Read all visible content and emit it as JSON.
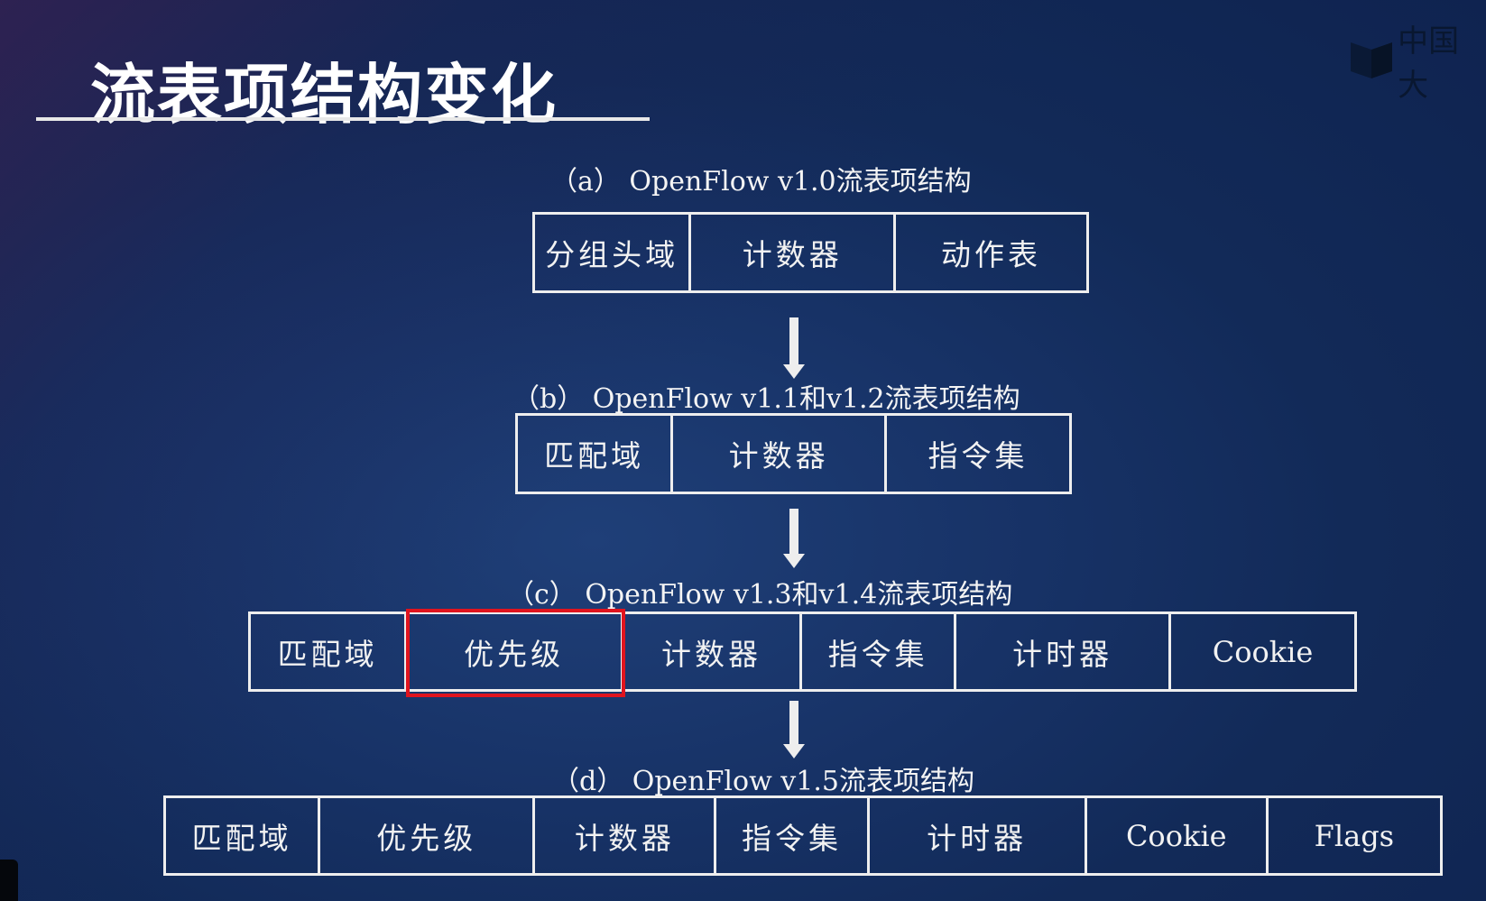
{
  "slide": {
    "title": "流表项结构变化",
    "logo_text": "中国大",
    "highlight_color": "#e0141e",
    "sections": [
      {
        "label": "（a） OpenFlow v1.0流表项结构",
        "cells": [
          "分组头域",
          "计数器",
          "动作表"
        ]
      },
      {
        "label": "（b） OpenFlow v1.1和v1.2流表项结构",
        "cells": [
          "匹配域",
          "计数器",
          "指令集"
        ]
      },
      {
        "label": "（c） OpenFlow v1.3和v1.4流表项结构",
        "cells": [
          "匹配域",
          "优先级",
          "计数器",
          "指令集",
          "计时器",
          "Cookie"
        ],
        "highlighted_cell": "优先级"
      },
      {
        "label": "（d） OpenFlow v1.5流表项结构",
        "cells": [
          "匹配域",
          "优先级",
          "计数器",
          "指令集",
          "计时器",
          "Cookie",
          "Flags"
        ]
      }
    ]
  }
}
